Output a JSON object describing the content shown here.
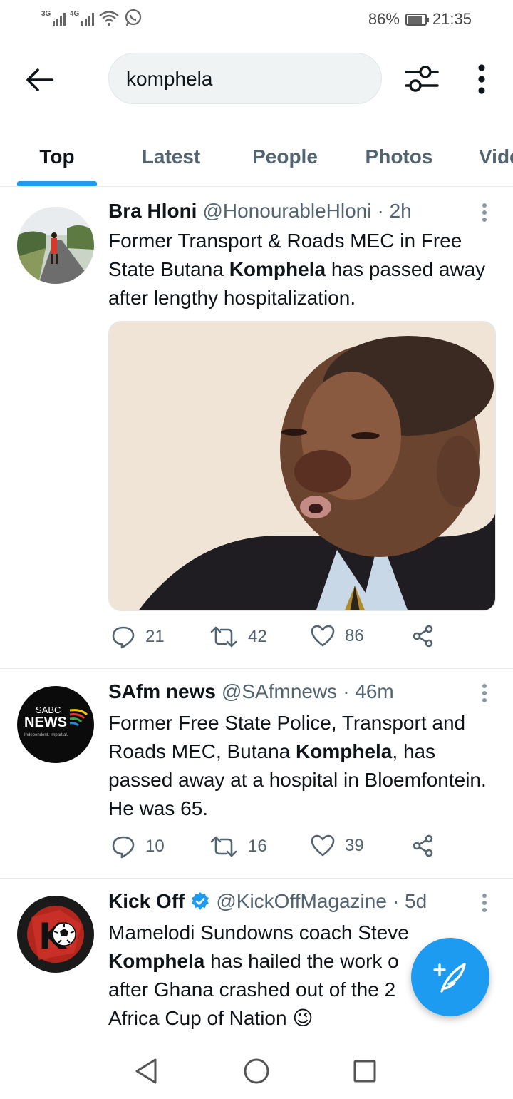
{
  "status_bar": {
    "network_1": "3G",
    "network_2": "4G",
    "battery": "86%",
    "battery_level": 0.86,
    "time": "21:35"
  },
  "search": {
    "query": "komphela"
  },
  "tabs": [
    {
      "label": "Top",
      "active": true
    },
    {
      "label": "Latest",
      "active": false
    },
    {
      "label": "People",
      "active": false
    },
    {
      "label": "Photos",
      "active": false
    },
    {
      "label": "Videos",
      "active": false
    }
  ],
  "tweets": [
    {
      "name": "Bra Hloni",
      "handle": "@HonourableHloni",
      "time": "· 2h",
      "text_parts": [
        "Former Transport & Roads MEC in Free State Butana ",
        "Komphela",
        " has passed away after lengthy hospitalization."
      ],
      "replies": "21",
      "retweets": "42",
      "likes": "86"
    },
    {
      "name": "SAfm news",
      "handle": "@SAfmnews",
      "time": "· 46m",
      "avatar_label_1": "SABC",
      "avatar_label_2": "NEWS",
      "avatar_tagline": "Independent. Impartial.",
      "text_parts": [
        "Former Free State Police, Transport and Roads MEC, Butana ",
        "Komphela",
        ", has passed away at a hospital in Bloemfontein. He was 65."
      ],
      "replies": "10",
      "retweets": "16",
      "likes": "39"
    },
    {
      "name": "Kick Off",
      "handle": "@KickOffMagazine",
      "time": "· 5d",
      "verified": true,
      "avatar_label": "K",
      "text_parts": [
        "Mamelodi Sundowns coach Steve ",
        "Komphela",
        " has hailed the work o",
        "after Ghana crashed out of the 2",
        "Africa Cup of Nation 😉"
      ]
    }
  ],
  "icons": {
    "back": "arrow-left-icon",
    "filter": "sliders-icon",
    "more": "more-vertical-icon",
    "reply": "reply-icon",
    "retweet": "retweet-icon",
    "like": "heart-icon",
    "share": "share-icon",
    "compose": "compose-icon"
  },
  "colors": {
    "accent": "#1d9bf0",
    "text": "#0f1419",
    "muted": "#536471"
  }
}
